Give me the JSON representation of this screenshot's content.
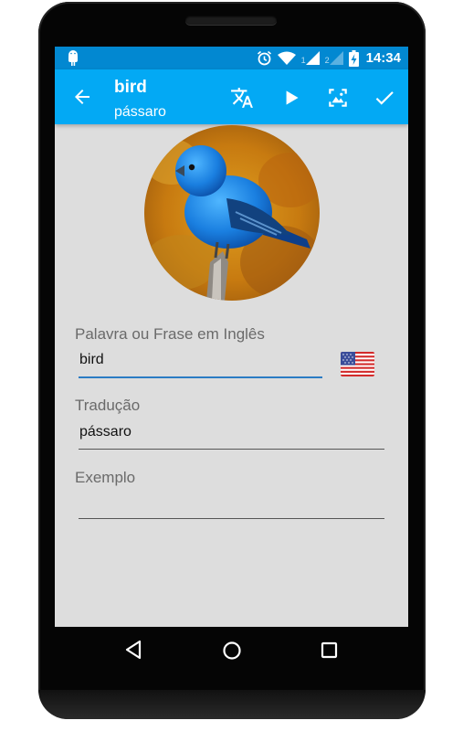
{
  "status_bar": {
    "time": "14:34",
    "sim1_label": "1",
    "sim2_label": "2",
    "icons": [
      "android-icon",
      "alarm-icon",
      "wifi-icon",
      "signal-icon",
      "signal-empty-icon",
      "battery-charging-icon"
    ]
  },
  "app_bar": {
    "title": "bird",
    "subtitle": "pássaro",
    "actions": [
      "translate-icon",
      "play-icon",
      "image-icon",
      "check-icon"
    ],
    "color": "#03a9f4",
    "status_color": "#0288d1"
  },
  "form": {
    "english_label": "Palavra ou Frase em Inglês",
    "english_value": "bird",
    "translation_label": "Tradução",
    "translation_value": "pássaro",
    "example_label": "Exemplo",
    "example_value": ""
  },
  "navigation": {
    "buttons": [
      "back-triangle-icon",
      "home-circle-icon",
      "recents-square-icon"
    ]
  }
}
